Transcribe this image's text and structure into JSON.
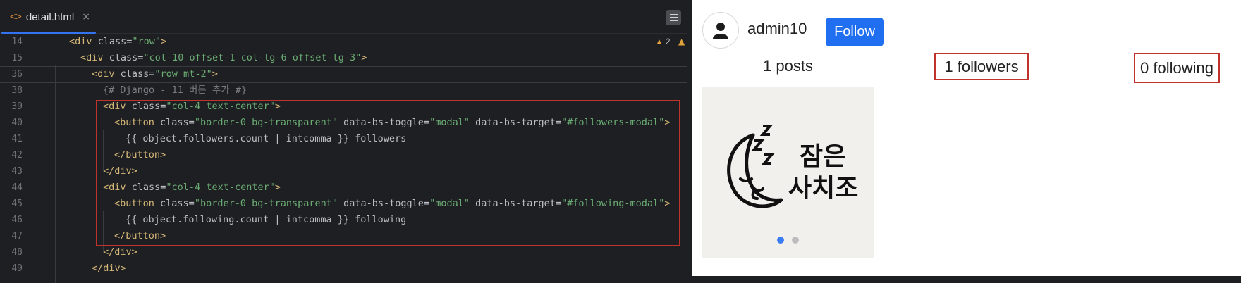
{
  "editor": {
    "tab": {
      "icon": "html-tag-icon",
      "icon_text": "<>",
      "filename": "detail.html",
      "close": "×"
    },
    "inspection": {
      "count": "2"
    },
    "lines": [
      {
        "num": "14",
        "indent": 0,
        "code": [
          [
            "t-tag",
            "<div "
          ],
          [
            "t-attr",
            "class="
          ],
          [
            "t-str",
            "\"row\""
          ],
          [
            "t-tag",
            ">"
          ]
        ]
      },
      {
        "num": "15",
        "indent": 1,
        "code": [
          [
            "t-tag",
            "<div "
          ],
          [
            "t-attr",
            "class="
          ],
          [
            "t-str",
            "\"col-10 offset-1 col-lg-6 offset-lg-3\""
          ],
          [
            "t-tag",
            ">"
          ]
        ]
      },
      {
        "num": "36",
        "indent": 2,
        "code": [
          [
            "t-tag",
            "<div "
          ],
          [
            "t-attr",
            "class="
          ],
          [
            "t-str",
            "\"row mt-2\""
          ],
          [
            "t-tag",
            ">"
          ]
        ]
      },
      {
        "num": "38",
        "indent": 3,
        "code": [
          [
            "t-cmt",
            "{# Django - 11 버튼 추가 #}"
          ]
        ]
      },
      {
        "num": "39",
        "indent": 3,
        "code": [
          [
            "t-tag",
            "<div "
          ],
          [
            "t-attr",
            "class="
          ],
          [
            "t-str",
            "\"col-4 text-center\""
          ],
          [
            "t-tag",
            ">"
          ]
        ]
      },
      {
        "num": "40",
        "indent": 4,
        "code": [
          [
            "t-tag",
            "<button "
          ],
          [
            "t-attr",
            "class="
          ],
          [
            "t-str",
            "\"border-0 bg-transparent\""
          ],
          [
            "t-attr",
            " data-bs-toggle="
          ],
          [
            "t-str",
            "\"modal\""
          ],
          [
            "t-attr",
            " data-bs-target="
          ],
          [
            "t-str",
            "\"#followers-modal\""
          ],
          [
            "t-tag",
            ">"
          ]
        ]
      },
      {
        "num": "41",
        "indent": 5,
        "code": [
          [
            "t-tpl",
            "{{ object.followers.count | intcomma }} followers"
          ]
        ]
      },
      {
        "num": "42",
        "indent": 4,
        "code": [
          [
            "t-tag",
            "</button>"
          ]
        ]
      },
      {
        "num": "43",
        "indent": 3,
        "code": [
          [
            "t-tag",
            "</div>"
          ]
        ]
      },
      {
        "num": "44",
        "indent": 3,
        "code": [
          [
            "t-tag",
            "<div "
          ],
          [
            "t-attr",
            "class="
          ],
          [
            "t-str",
            "\"col-4 text-center\""
          ],
          [
            "t-tag",
            ">"
          ]
        ]
      },
      {
        "num": "45",
        "indent": 4,
        "code": [
          [
            "t-tag",
            "<button "
          ],
          [
            "t-attr",
            "class="
          ],
          [
            "t-str",
            "\"border-0 bg-transparent\""
          ],
          [
            "t-attr",
            " data-bs-toggle="
          ],
          [
            "t-str",
            "\"modal\""
          ],
          [
            "t-attr",
            " data-bs-target="
          ],
          [
            "t-str",
            "\"#following-modal\""
          ],
          [
            "t-tag",
            ">"
          ]
        ]
      },
      {
        "num": "46",
        "indent": 5,
        "code": [
          [
            "t-tpl",
            "{{ object.following.count | intcomma }} following"
          ]
        ]
      },
      {
        "num": "47",
        "indent": 4,
        "code": [
          [
            "t-tag",
            "</button>"
          ]
        ]
      },
      {
        "num": "48",
        "indent": 3,
        "code": [
          [
            "t-tag",
            "</div>"
          ]
        ]
      },
      {
        "num": "49",
        "indent": 2,
        "code": [
          [
            "t-tag",
            "</div>"
          ]
        ]
      }
    ]
  },
  "preview": {
    "username": "admin10",
    "follow_label": "Follow",
    "posts": "1 posts",
    "followers": "1 followers",
    "following": "0 following",
    "post_image": {
      "line1": "잠은",
      "line2": "사치조"
    },
    "carousel": {
      "total": 2,
      "active": 1
    },
    "colors": {
      "follow_button": "#1f6ff0",
      "highlight": "#c0322c",
      "dot_active": "#3a7cf2"
    }
  }
}
